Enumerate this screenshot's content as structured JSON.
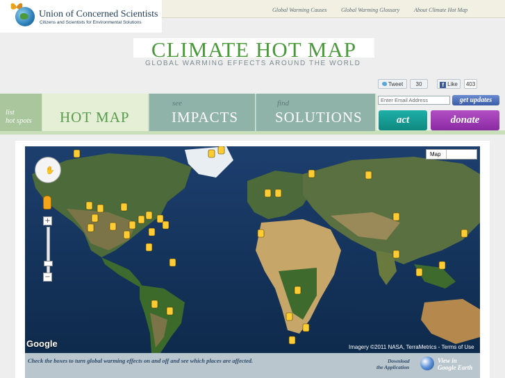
{
  "org": {
    "name": "Union of Concerned Scientists",
    "tagline": "Citizens and Scientists for Environmental Solutions"
  },
  "top_nav": [
    "Global Warming Causes",
    "Global Warming Glossary",
    "About Climate Hot Map"
  ],
  "banner": {
    "title": "CLIMATE HOT MAP",
    "subtitle": "GLOBAL WARMING EFFECTS AROUND THE WORLD"
  },
  "social": {
    "tweet_label": "Tweet",
    "tweet_count": "30",
    "like_label": "Like",
    "like_count": "403"
  },
  "nav": {
    "list_line1": "list",
    "list_line2": "hot spots",
    "hotmap_label": "HOT MAP",
    "impacts_small": "see",
    "impacts_label": "IMPACTS",
    "solutions_small": "find",
    "solutions_label": "SOLUTIONS"
  },
  "signup": {
    "email_placeholder": "Enter Email Address",
    "button": "get updates"
  },
  "actions": {
    "act": "act",
    "donate": "donate"
  },
  "map": {
    "type_label": "Map",
    "zoom_in": "+",
    "zoom_out": "−",
    "google": "Google",
    "attribution": "Imagery ©2011 NASA, TerraMetrics - Terms of Use"
  },
  "footer": {
    "instruction": "Check the boxes to turn global warming effects on and off and see which places are affected.",
    "download_line1": "Download",
    "download_line2": "the Application",
    "ge_line1": "View in",
    "ge_line2": "Google Earth"
  },
  "colors": {
    "banner_green": "#4a9a3c",
    "act": "#1fb0a8",
    "donate": "#8a2aa3",
    "ocean": "#14335a"
  }
}
